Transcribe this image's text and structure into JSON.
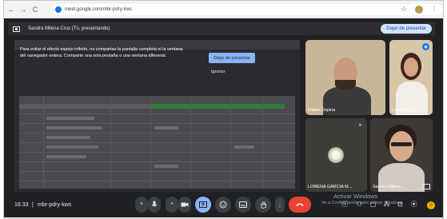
{
  "browser": {
    "url": "meet.google.com/mbr-pdry-kws",
    "nav_back": "←",
    "nav_forward": "→",
    "nav_reload": "C",
    "star_icon": "star-icon",
    "star_glyph": "☆",
    "kebab_glyph": "⋮"
  },
  "presenting_bar": {
    "text": "Sandra Milena Cruz (Tú, presentando)",
    "stop_button": "Dejar de presentar"
  },
  "shared_screen": {
    "warning": "Para evitar el efecto espejo infinito, no compartas la pantalla completa ni la ventana del navegador entera. Comparte una sola pestaña o una ventana diferente.",
    "stop_button": "Dejar de presentar",
    "ignore_button": "Ignorar"
  },
  "participants": [
    {
      "name": "Mateo Ospina"
    },
    {
      "name": "Lorena Ga..."
    },
    {
      "name": "LORENA GARCIA M..."
    },
    {
      "name": "Sandra Milena ..."
    }
  ],
  "bottom_bar": {
    "time": "16:33",
    "separator": "|",
    "meeting_code": "mbr-pdry-kws"
  },
  "watermark": {
    "line1": "Activar Windows",
    "line2": "Ve a Configuración para activar Windows."
  },
  "colors": {
    "meet_bg": "#202124",
    "accent": "#8ab4f8",
    "end_call": "#ea4335"
  }
}
